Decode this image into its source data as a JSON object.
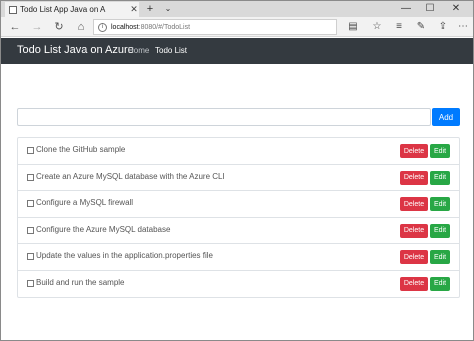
{
  "browser": {
    "tab_title": "Todo List App Java on A",
    "url_host": "localhost",
    "url_path": ":8080/#/TodoList"
  },
  "nav": {
    "brand": "Todo List Java on Azure",
    "links": [
      {
        "label": "Home"
      },
      {
        "label": "Todo List"
      }
    ]
  },
  "form": {
    "input_value": "",
    "add_label": "Add"
  },
  "todos": [
    {
      "label": "Clone the GitHub sample",
      "delete_label": "Delete",
      "edit_label": "Edit"
    },
    {
      "label": "Create an Azure MySQL database with the Azure CLI",
      "delete_label": "Delete",
      "edit_label": "Edit"
    },
    {
      "label": "Configure a MySQL firewall",
      "delete_label": "Delete",
      "edit_label": "Edit"
    },
    {
      "label": "Configure the Azure MySQL database",
      "delete_label": "Delete",
      "edit_label": "Edit"
    },
    {
      "label": "Update the values in the application.properties file",
      "delete_label": "Delete",
      "edit_label": "Edit"
    },
    {
      "label": "Build and run the sample",
      "delete_label": "Delete",
      "edit_label": "Edit"
    }
  ],
  "colors": {
    "navbar": "#343a40",
    "primary": "#007bff",
    "danger": "#dc3545",
    "success": "#28a745"
  }
}
